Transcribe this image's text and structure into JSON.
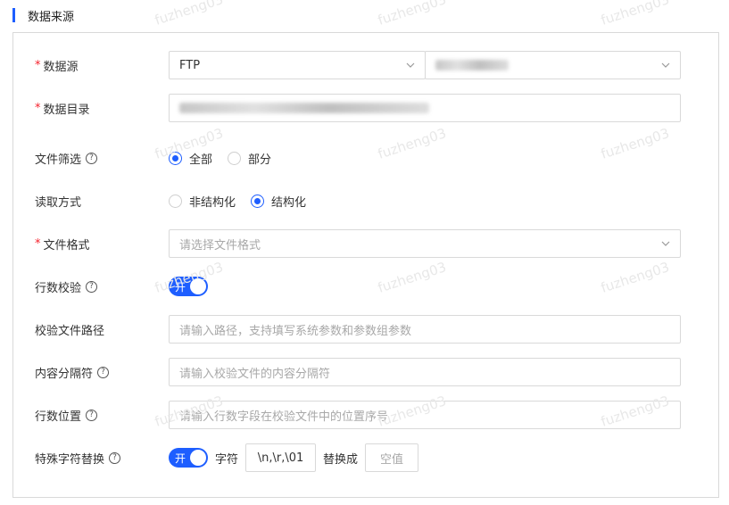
{
  "section": {
    "title": "数据来源"
  },
  "form": {
    "data_source": {
      "label": "数据源",
      "type_value": "FTP"
    },
    "data_dir": {
      "label": "数据目录"
    },
    "file_filter": {
      "label": "文件筛选",
      "options": [
        "全部",
        "部分"
      ],
      "selected": "全部"
    },
    "read_mode": {
      "label": "读取方式",
      "options": [
        "非结构化",
        "结构化"
      ],
      "selected": "结构化"
    },
    "file_format": {
      "label": "文件格式",
      "placeholder": "请选择文件格式"
    },
    "row_check": {
      "label": "行数校验",
      "switch_text": "开",
      "enabled": true
    },
    "check_path": {
      "label": "校验文件路径",
      "placeholder": "请输入路径，支持填写系统参数和参数组参数"
    },
    "delimiter": {
      "label": "内容分隔符",
      "placeholder": "请输入校验文件的内容分隔符"
    },
    "row_position": {
      "label": "行数位置",
      "placeholder": "请输入行数字段在校验文件中的位置序号"
    },
    "special_char": {
      "label": "特殊字符替换",
      "switch_text": "开",
      "enabled": true,
      "char_label": "字符",
      "char_value": "\\n,\\r,\\01",
      "replace_label": "替换成",
      "replace_placeholder": "空值"
    }
  },
  "watermark": {
    "text": "fuzheng03"
  },
  "colors": {
    "accent": "#1e5eff",
    "required": "#f5222d",
    "border": "#d9d9d9"
  },
  "icons": {
    "select_arrow": "chevron-down-icon",
    "help": "question-circle-icon"
  }
}
